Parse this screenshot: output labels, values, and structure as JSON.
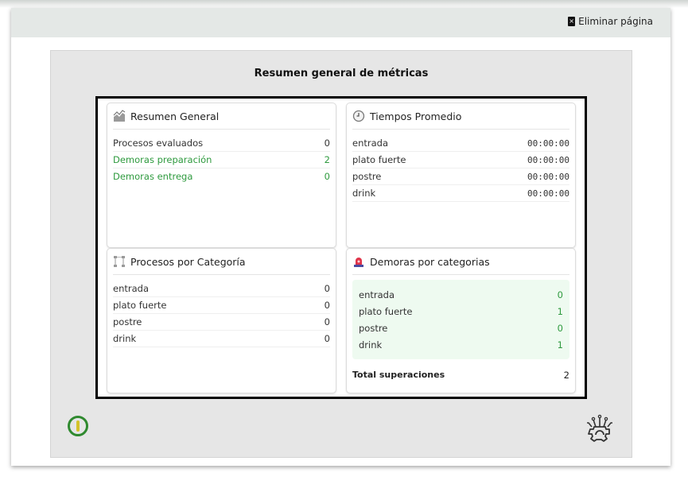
{
  "header": {
    "delete_label": "Eliminar página"
  },
  "page": {
    "title": "Resumen general de métricas"
  },
  "summary": {
    "title": "Resumen General",
    "rows": [
      {
        "label": "Procesos evaluados",
        "value": "0"
      },
      {
        "label": "Demoras preparación",
        "value": "2"
      },
      {
        "label": "Demoras entrega",
        "value": "0"
      }
    ]
  },
  "times": {
    "title": "Tiempos Promedio",
    "rows": [
      {
        "label": "entrada",
        "value": "00:00:00"
      },
      {
        "label": "plato fuerte",
        "value": "00:00:00"
      },
      {
        "label": "postre",
        "value": "00:00:00"
      },
      {
        "label": "drink",
        "value": "00:00:00"
      }
    ]
  },
  "processes": {
    "title": "Procesos por Categoría",
    "rows": [
      {
        "label": "entrada",
        "value": "0"
      },
      {
        "label": "plato fuerte",
        "value": "0"
      },
      {
        "label": "postre",
        "value": "0"
      },
      {
        "label": "drink",
        "value": "0"
      }
    ]
  },
  "delays": {
    "title": "Demoras por categorias",
    "rows": [
      {
        "label": "entrada",
        "value": "0"
      },
      {
        "label": "plato fuerte",
        "value": "1"
      },
      {
        "label": "postre",
        "value": "0"
      },
      {
        "label": "drink",
        "value": "1"
      }
    ],
    "total_label": "Total superaciones",
    "total_value": "2"
  },
  "colors": {
    "accent_green": "#2e9a3e",
    "header_bg": "#e4e8e6",
    "canvas_bg": "#e6e6e6"
  },
  "icons": {
    "summary": "area-chart-icon",
    "times": "clock-icon",
    "processes": "flow-icon",
    "delays": "alarm-light-icon",
    "delete": "trash-icon",
    "power": "power-icon",
    "gear": "gear-circuit-icon"
  }
}
